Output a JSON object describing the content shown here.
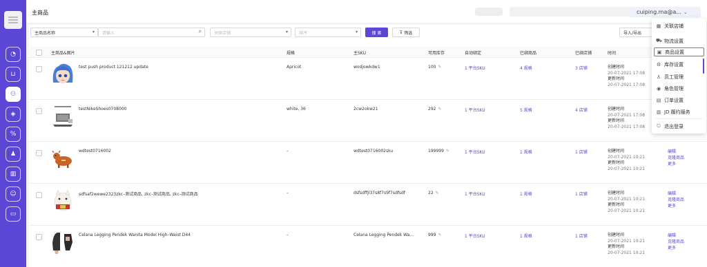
{
  "header": {
    "page_title": "主商品",
    "user": "cuiping.ma@a..."
  },
  "filters": {
    "name_select": "主商品名称",
    "search_placeholder": "请输入",
    "store_placeholder": "关联店铺",
    "sort_placeholder": "排序",
    "search_label": "搜 索",
    "filter_label": "筛选",
    "impexp_label": "导入/导出"
  },
  "columns": [
    "主商品&图片",
    "规格",
    "主SKU",
    "可用库存",
    "自动绑定",
    "已绑商品",
    "已绑店铺",
    "时间"
  ],
  "rows": [
    {
      "name": "test push product 121212 update",
      "spec": "Apricot",
      "sku": "wodjowkdw1",
      "stock": "100",
      "bind": "1 平台SKU",
      "bound": "4 规格",
      "stores": "3 店铺",
      "created_label": "创建时间",
      "created": "20-07-2021 17:08",
      "updated_label": "更新时间",
      "updated": "20-07-2021 17:08",
      "actions": []
    },
    {
      "name": "testNikeShoes0708000",
      "spec": "white, 36",
      "sku": "2cw2okw21",
      "stock": "292",
      "bind": "1 平台SKU",
      "bound": "5 规格",
      "stores": "4 店铺",
      "created_label": "创建时间",
      "created": "20-07-2021 17:08",
      "updated_label": "更新时间",
      "updated": "20-07-2021 17:08",
      "actions": []
    },
    {
      "name": "wdtest0716002",
      "spec": "–",
      "sku": "wdtest0716002sku",
      "stock": "199999",
      "bind": "1 平台SKU",
      "bound": "1 规格",
      "stores": "1 店铺",
      "created_label": "创建时间",
      "created": "20-07-2021 10:21",
      "updated_label": "更新时间",
      "updated": "20-07-2021 10:21",
      "actions": [
        "编辑",
        "克隆商品",
        "更多"
      ]
    },
    {
      "name": "sdfsaf2wewe2323zkc–测试商品, zkc–测试商品, zkc–测试商品",
      "spec": "–",
      "sku": "dsfsdffjl37s8f7s9f7sdfsdf",
      "stock": "22",
      "bind": "1 平台SKU",
      "bound": "1 规格",
      "stores": "1 店铺",
      "created_label": "创建时间",
      "created": "20-07-2021 10:21",
      "updated_label": "更新时间",
      "updated": "20-07-2021 10:21",
      "actions": [
        "编辑",
        "克隆商品",
        "更多"
      ]
    },
    {
      "name": "Celana Legging Pendek Wanita Model High–Waist D44",
      "spec": "–",
      "sku": "Celana Legging Pendek Wa...",
      "stock": "999",
      "bind": "1 平台SKU",
      "bound": "1 规格",
      "stores": "1 店铺",
      "created_label": "创建时间",
      "created": "20-07-2021 10:21",
      "updated_label": "更新时间",
      "updated": "20-07-2021 10:21",
      "actions": [
        "编辑",
        "克隆商品",
        "更多"
      ]
    }
  ],
  "dropdown": [
    {
      "label": "关联店铺",
      "icon": "store-icon",
      "glyph": "▦"
    },
    {
      "label": "物流设置",
      "icon": "truck-icon",
      "glyph": "⛟"
    },
    {
      "label": "商品设置",
      "icon": "product-icon",
      "glyph": "▣",
      "highlight": true
    },
    {
      "label": "库存设置",
      "icon": "gear-icon",
      "glyph": "⚙"
    },
    {
      "label": "员工管理",
      "icon": "user-icon",
      "glyph": "♙"
    },
    {
      "label": "角色管理",
      "icon": "role-icon",
      "glyph": "◉"
    },
    {
      "label": "订单设置",
      "icon": "order-icon",
      "glyph": "▤"
    },
    {
      "label": "JD 履约服务",
      "icon": "service-icon",
      "glyph": "▥"
    },
    {
      "label": "退出登录",
      "icon": "logout-icon",
      "glyph": "⎋"
    }
  ],
  "colors": {
    "accent": "#5b46d6",
    "highlight": "#d9534f"
  }
}
